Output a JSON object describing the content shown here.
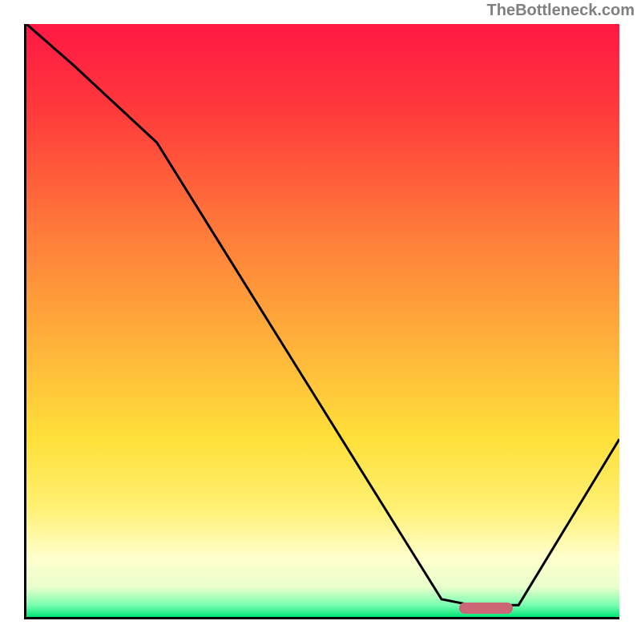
{
  "watermark": "TheBottleneck.com",
  "chart_data": {
    "type": "line",
    "title": "",
    "xlabel": "",
    "ylabel": "",
    "xlim": [
      0,
      100
    ],
    "ylim": [
      0,
      100
    ],
    "grid": false,
    "legend": false,
    "background_gradient": {
      "type": "linear-vertical",
      "stops": [
        {
          "offset": 0,
          "color": "#ff1744"
        },
        {
          "offset": 15,
          "color": "#ff3b3b"
        },
        {
          "offset": 35,
          "color": "#ff7b3a"
        },
        {
          "offset": 55,
          "color": "#ffb53a"
        },
        {
          "offset": 70,
          "color": "#ffe03a"
        },
        {
          "offset": 82,
          "color": "#fff176"
        },
        {
          "offset": 90,
          "color": "#ffffcc"
        },
        {
          "offset": 95,
          "color": "#e8ffcc"
        },
        {
          "offset": 98,
          "color": "#7affb0"
        },
        {
          "offset": 100,
          "color": "#00e676"
        }
      ]
    },
    "series": [
      {
        "name": "bottleneck-curve",
        "x": [
          0,
          8,
          22,
          70,
          75,
          83,
          100
        ],
        "y": [
          100,
          93,
          80,
          3,
          2,
          2,
          30
        ]
      }
    ],
    "marker": {
      "name": "optimal-range-marker",
      "x_start": 73,
      "x_end": 82,
      "y": 1.5,
      "color": "#cc6677"
    }
  }
}
